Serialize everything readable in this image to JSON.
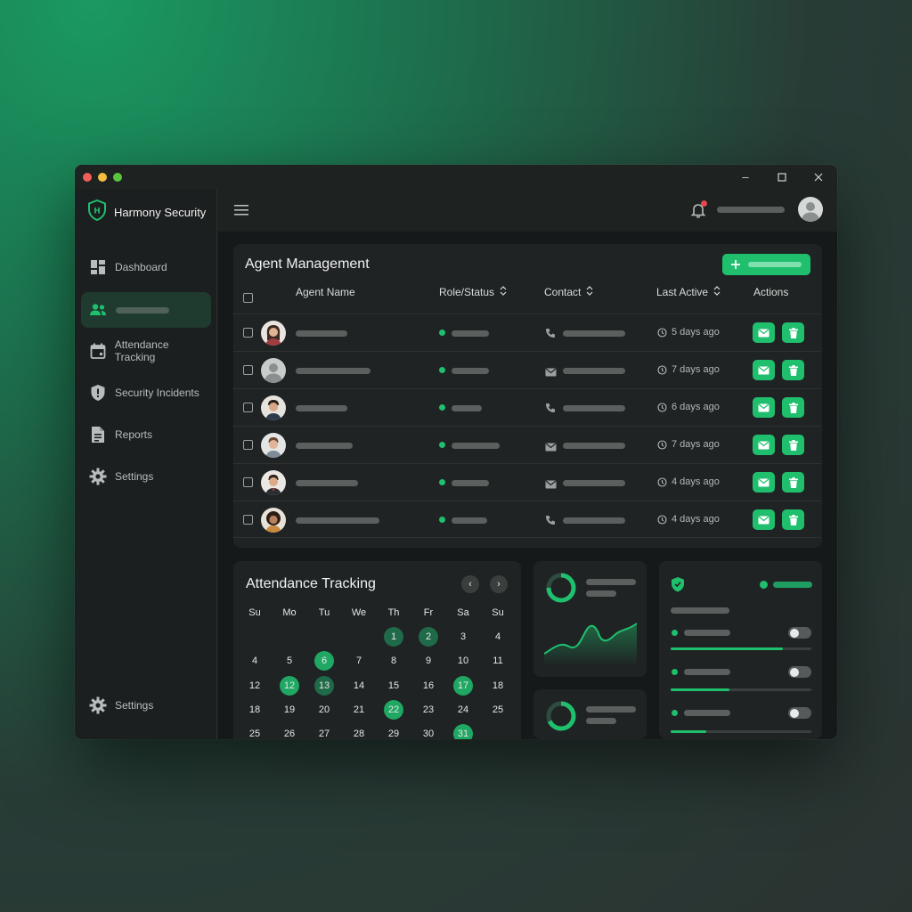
{
  "app": {
    "title": "Harmony Security"
  },
  "sidebar": {
    "items": [
      {
        "label": "Dashboard",
        "icon": "dashboard-icon"
      },
      {
        "label": "",
        "icon": "users-icon",
        "active": true
      },
      {
        "label": "Attendance Tracking",
        "icon": "calendar-icon"
      },
      {
        "label": "Security Incidents",
        "icon": "shield-alert-icon"
      },
      {
        "label": "Reports",
        "icon": "document-icon"
      },
      {
        "label": "Settings",
        "icon": "gear-icon"
      }
    ],
    "footer_label": "Settings"
  },
  "agents": {
    "title": "Agent Management",
    "columns": [
      "Agent Name",
      "Role/Status",
      "Contact",
      "Last Active",
      "Actions"
    ],
    "rows": [
      {
        "contact_icon": "phone-icon",
        "last_active": "5 days ago",
        "status_level": "active"
      },
      {
        "contact_icon": "mail-icon",
        "last_active": "7 days ago",
        "status_level": "active"
      },
      {
        "contact_icon": "phone-icon",
        "last_active": "6 days ago",
        "status_level": "active"
      },
      {
        "contact_icon": "mail-icon",
        "last_active": "7 days ago",
        "status_level": "active"
      },
      {
        "contact_icon": "mail-icon",
        "last_active": "4 days ago",
        "status_level": "active"
      },
      {
        "contact_icon": "phone-icon",
        "last_active": "4 days ago",
        "status_level": "active"
      }
    ]
  },
  "attendance": {
    "title": "Attendance Tracking",
    "weekdays": [
      "Su",
      "Mo",
      "Tu",
      "We",
      "Th",
      "Fr",
      "Sa",
      "Su"
    ],
    "weeks": [
      [
        "",
        "",
        "",
        "",
        "1",
        "2",
        "3",
        "4"
      ],
      [
        "4",
        "5",
        "6",
        "7",
        "8",
        "9",
        "10",
        "11"
      ],
      [
        "12",
        "12",
        "13",
        "14",
        "15",
        "16",
        "17",
        "18"
      ],
      [
        "18",
        "19",
        "20",
        "21",
        "22",
        "23",
        "24",
        "25"
      ],
      [
        "25",
        "26",
        "27",
        "28",
        "29",
        "30",
        "31",
        ""
      ]
    ],
    "highlighted_dark": [
      "1",
      "2",
      "13"
    ],
    "highlighted_bright": [
      "6",
      "12",
      "17",
      "22",
      "31"
    ]
  },
  "settings_panel": {
    "toggles": [
      {
        "on": false,
        "progress": 0.8
      },
      {
        "on": false,
        "progress": 0.42
      },
      {
        "on": false,
        "progress": 0.25
      }
    ]
  },
  "colors": {
    "accent": "#1fbf6e",
    "notification": "#e5484d"
  }
}
